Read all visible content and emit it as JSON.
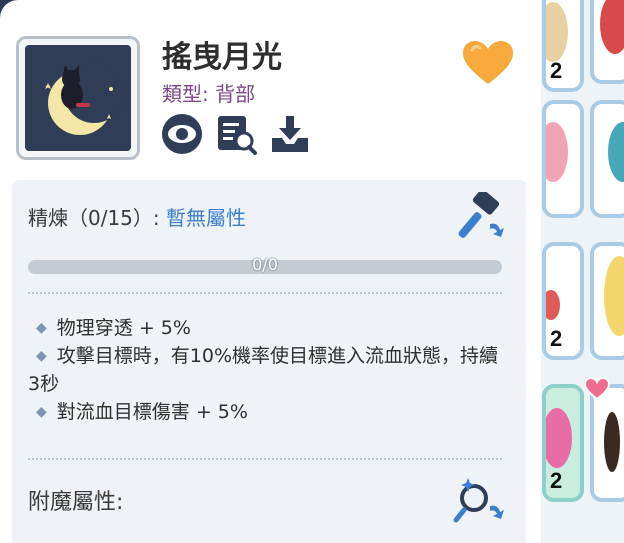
{
  "item": {
    "name": "搖曳月光",
    "type_label": "類型: 背部",
    "icon_name": "moon-cat-back-icon"
  },
  "actions": [
    {
      "name": "view-button",
      "icon": "eye-icon"
    },
    {
      "name": "inspect-button",
      "icon": "magnify-document-icon"
    },
    {
      "name": "save-button",
      "icon": "download-tray-icon"
    }
  ],
  "favorite": {
    "icon": "heart-icon",
    "color": "#f7a93c"
  },
  "refine": {
    "label": "精煉（0/15）:",
    "value": "暫無屬性",
    "progress_text": "0/0",
    "progress": 0
  },
  "effects": [
    "物理穿透 + 5%",
    "攻擊目標時，有10%機率使目標進入流血狀態，持續3秒",
    "對流血目標傷害 + 5%"
  ],
  "enchant": {
    "label": "附魔屬性:"
  },
  "inventory": [
    {
      "count": "2"
    },
    {
      "count": ""
    },
    {
      "count": ""
    },
    {
      "count": ""
    },
    {
      "count": "2"
    },
    {
      "count": ""
    },
    {
      "count": "2"
    },
    {
      "count": ""
    }
  ],
  "colors": {
    "accent_blue": "#3c7fcf",
    "slot_border": "#a9cbe6",
    "heart": "#f7a93c"
  }
}
